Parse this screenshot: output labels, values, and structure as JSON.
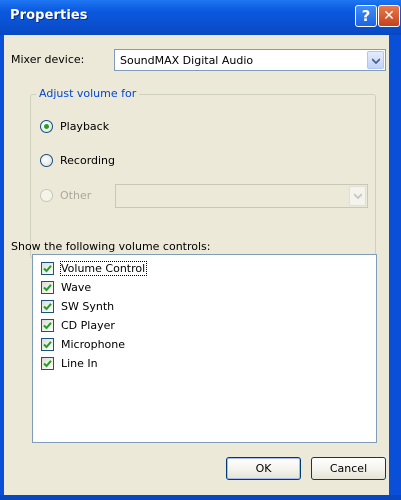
{
  "window": {
    "title": "Properties",
    "help_button": "?",
    "close_button": "✕"
  },
  "mixer": {
    "label": "Mixer device:",
    "selected": "SoundMAX Digital Audio"
  },
  "adjust": {
    "group_label": "Adjust volume for",
    "options": [
      {
        "label": "Playback",
        "selected": true,
        "enabled": true
      },
      {
        "label": "Recording",
        "selected": false,
        "enabled": true
      },
      {
        "label": "Other",
        "selected": false,
        "enabled": false
      }
    ],
    "other_combo_value": ""
  },
  "controls": {
    "label": "Show the following volume controls:",
    "items": [
      {
        "label": "Volume Control",
        "checked": true
      },
      {
        "label": "Wave",
        "checked": true
      },
      {
        "label": "SW Synth",
        "checked": true
      },
      {
        "label": "CD Player",
        "checked": true
      },
      {
        "label": "Microphone",
        "checked": true
      },
      {
        "label": "Line In",
        "checked": true
      }
    ]
  },
  "buttons": {
    "ok": "OK",
    "cancel": "Cancel"
  },
  "icons": {
    "help": "help-icon",
    "close": "close-icon",
    "dropdown": "chevron-down-icon",
    "check": "checkmark-icon"
  },
  "colors": {
    "titlebar": "#0a50d0",
    "dialog_bg": "#ece9d8",
    "group_label": "#0046d5",
    "check_mark": "#21a121"
  }
}
